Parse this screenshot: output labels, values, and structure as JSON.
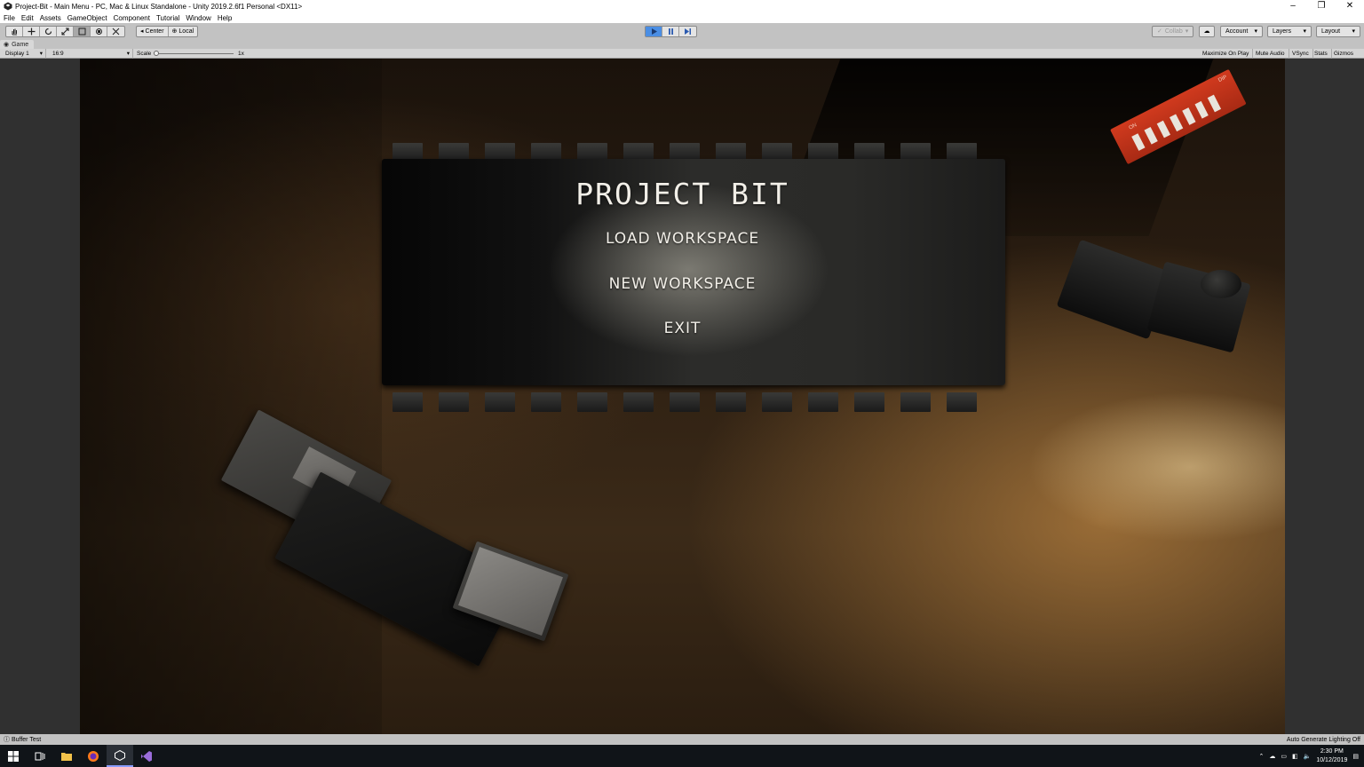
{
  "window": {
    "title": "Project-Bit - Main Menu - PC, Mac & Linux Standalone - Unity 2019.2.6f1 Personal <DX11>",
    "controls": [
      "–",
      "❐",
      "✕"
    ]
  },
  "menubar": {
    "items": [
      "File",
      "Edit",
      "Assets",
      "GameObject",
      "Component",
      "Tutorial",
      "Window",
      "Help"
    ]
  },
  "toolbar": {
    "pivot_label": "Center",
    "space_label": "Local",
    "collab_label": "Collab",
    "account_label": "Account",
    "layers_label": "Layers",
    "layout_label": "Layout",
    "play_active": true
  },
  "game_view": {
    "tab_label": "Game",
    "display_label": "Display 1",
    "aspect_label": "16:9",
    "scale_label": "Scale",
    "scale_value": "1x",
    "maximize_label": "Maximize On Play",
    "mute_label": "Mute Audio",
    "vsync_label": "VSync",
    "stats_label": "Stats",
    "gizmos_label": "Gizmos"
  },
  "scene": {
    "title": "PROJECT BIT",
    "menu_items": [
      "LOAD WORKSPACE",
      "NEW WORKSPACE",
      "EXIT"
    ],
    "dip_label_top": "ON",
    "dip_label_side": "DIP"
  },
  "statusbar": {
    "left_text": "Buffer Test",
    "right_text": "Auto Generate Lighting Off"
  },
  "taskbar": {
    "time": "2:30 PM",
    "date": "10/12/2019"
  },
  "colors": {
    "play_accent": "#4a8ee4",
    "chip_red": "#c23218",
    "editor_gray": "#c2c2c2"
  }
}
